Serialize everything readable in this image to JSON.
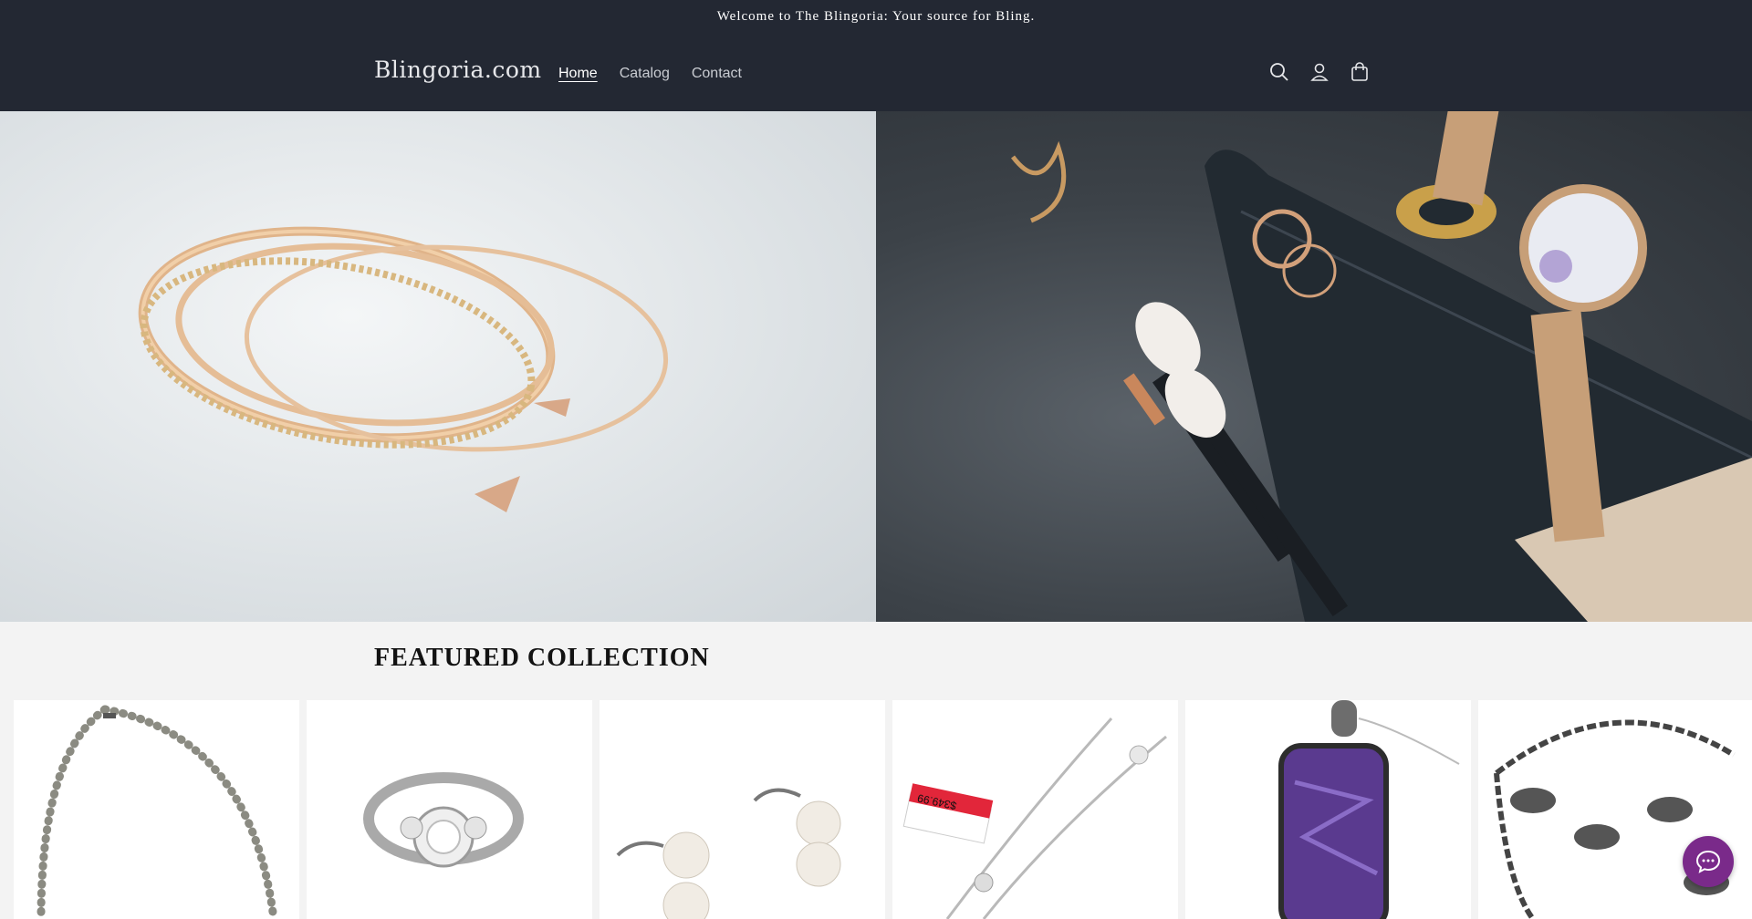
{
  "announcement": {
    "text": "Welcome to The Blingoria: Your source for Bling."
  },
  "header": {
    "logo": "Blingoria.com",
    "nav": [
      {
        "label": "Home",
        "active": true
      },
      {
        "label": "Catalog",
        "active": false
      },
      {
        "label": "Contact",
        "active": false
      }
    ],
    "icons": [
      "search-icon",
      "account-icon",
      "cart-icon"
    ]
  },
  "hero": {
    "left_image": "bangle-bracelets-image",
    "right_image": "watch-rings-brushes-image"
  },
  "featured": {
    "title": "FEATURED COLLECTION",
    "products": [
      {
        "image": "pearl-necklace-image"
      },
      {
        "image": "diamond-ring-image"
      },
      {
        "image": "pearl-earrings-image"
      },
      {
        "image": "slider-bracelet-image",
        "tag_text": "$349.99"
      },
      {
        "image": "purple-pendant-image"
      },
      {
        "image": "fish-charm-bracelet-image"
      }
    ]
  },
  "colors": {
    "header_bg": "#232833",
    "chat_accent": "#7a2a8a",
    "page_bg": "#f3f3f3"
  },
  "chat": {
    "icon": "chat-icon"
  }
}
